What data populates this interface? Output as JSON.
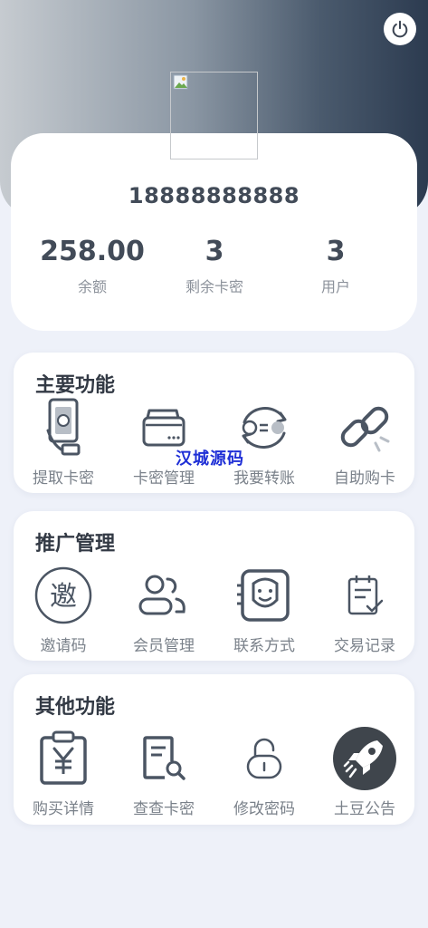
{
  "header": {
    "power_icon": "power-icon",
    "avatar_alt": "avatar"
  },
  "profile": {
    "phone": "18888888888",
    "stats": [
      {
        "value": "258.00",
        "label": "余额"
      },
      {
        "value": "3",
        "label": "剩余卡密"
      },
      {
        "value": "3",
        "label": "用户"
      }
    ]
  },
  "sections": [
    {
      "title": "主要功能",
      "items": [
        {
          "label": "提取卡密",
          "icon": "cash-hand-icon"
        },
        {
          "label": "卡密管理",
          "icon": "wallet-icon"
        },
        {
          "label": "我要转账",
          "icon": "exchange-icon"
        },
        {
          "label": "自助购卡",
          "icon": "link-icon"
        }
      ]
    },
    {
      "title": "推广管理",
      "items": [
        {
          "label": "邀请码",
          "icon": "invite-icon"
        },
        {
          "label": "会员管理",
          "icon": "members-icon"
        },
        {
          "label": "联系方式",
          "icon": "contact-face-icon"
        },
        {
          "label": "交易记录",
          "icon": "clipboard-check-icon"
        }
      ]
    },
    {
      "title": "其他功能",
      "items": [
        {
          "label": "购买详情",
          "icon": "yen-clipboard-icon"
        },
        {
          "label": "查查卡密",
          "icon": "document-search-icon"
        },
        {
          "label": "修改密码",
          "icon": "lock-icon"
        },
        {
          "label": "土豆公告",
          "icon": "rocket-icon"
        }
      ]
    }
  ],
  "invite_glyph": "邀",
  "watermark": "汉城源码"
}
